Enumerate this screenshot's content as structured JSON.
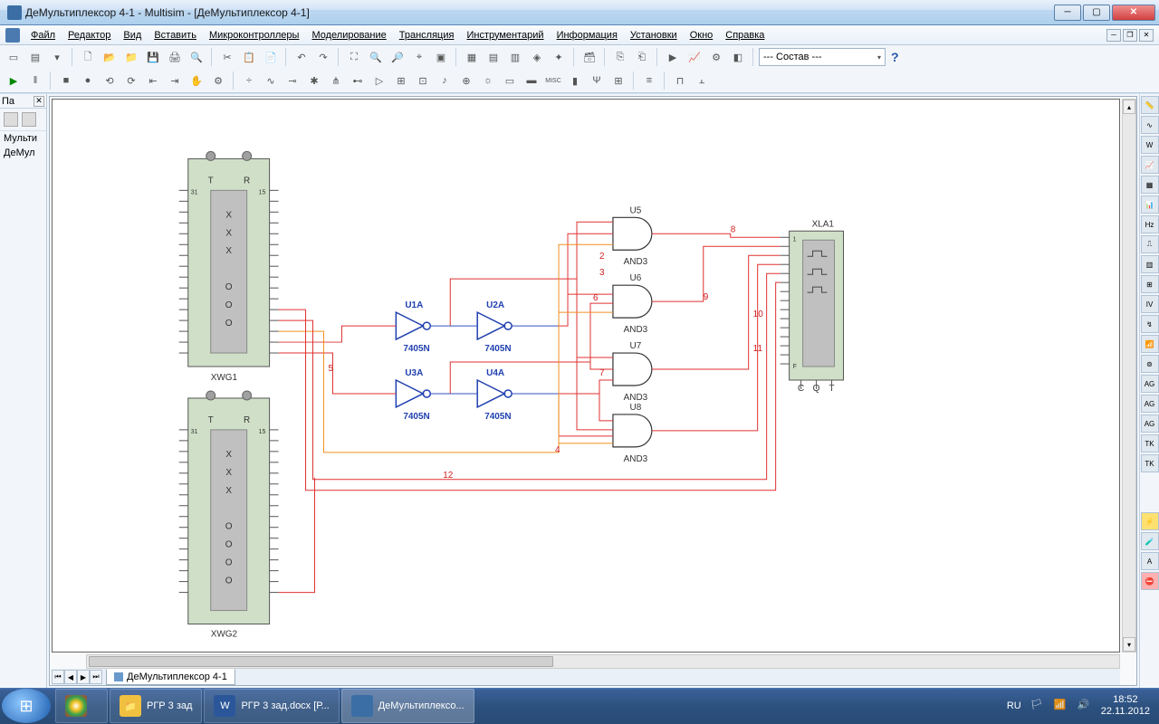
{
  "window": {
    "title": "ДеМультиплексор 4-1 - Multisim - [ДеМультиплексор 4-1]"
  },
  "menu": {
    "items": [
      "Файл",
      "Редактор",
      "Вид",
      "Вставить",
      "Микроконтроллеры",
      "Моделирование",
      "Трансляция",
      "Инструментарий",
      "Информация",
      "Установки",
      "Окно",
      "Справка"
    ]
  },
  "combo": {
    "value": "--- Состав ---"
  },
  "left_panel": {
    "title": "Пa",
    "items": [
      "Мульти",
      "ДеМул"
    ]
  },
  "tab": {
    "name": "ДеМультиплексор 4-1"
  },
  "circuit": {
    "xwg1": {
      "ref": "XWG1",
      "top": [
        "T",
        "R"
      ],
      "left31": "31",
      "right15": "15",
      "col1": [
        "X",
        "X",
        "X"
      ],
      "col2": [
        "O",
        "O",
        "O"
      ]
    },
    "xwg2": {
      "ref": "XWG2",
      "top": [
        "T",
        "R"
      ],
      "left31": "31",
      "right15": "15",
      "col1": [
        "X",
        "X",
        "X"
      ],
      "col2": [
        "O",
        "O",
        "O",
        "O"
      ]
    },
    "xla1": {
      "ref": "XLA1",
      "labels": [
        "1",
        "F",
        "C",
        "Q",
        "T"
      ]
    },
    "inverters": [
      {
        "ref": "U1A",
        "part": "7405N"
      },
      {
        "ref": "U2A",
        "part": "7405N"
      },
      {
        "ref": "U3A",
        "part": "7405N"
      },
      {
        "ref": "U4A",
        "part": "7405N"
      }
    ],
    "and_gates": [
      {
        "ref": "U5",
        "type": "AND3"
      },
      {
        "ref": "U6",
        "type": "AND3"
      },
      {
        "ref": "U7",
        "type": "AND3"
      },
      {
        "ref": "U8",
        "type": "AND3"
      }
    ],
    "net_labels": [
      "2",
      "3",
      "4",
      "5",
      "6",
      "7",
      "8",
      "9",
      "10",
      "11",
      "12"
    ]
  },
  "taskbar": {
    "items": [
      {
        "label": ""
      },
      {
        "label": ""
      },
      {
        "label": "РГР 3 зад"
      },
      {
        "label": "РГР 3 зад.docx [Р..."
      },
      {
        "label": "ДеМультиплексо..."
      }
    ],
    "lang": "RU",
    "time": "18:52",
    "date": "22.11.2012"
  }
}
